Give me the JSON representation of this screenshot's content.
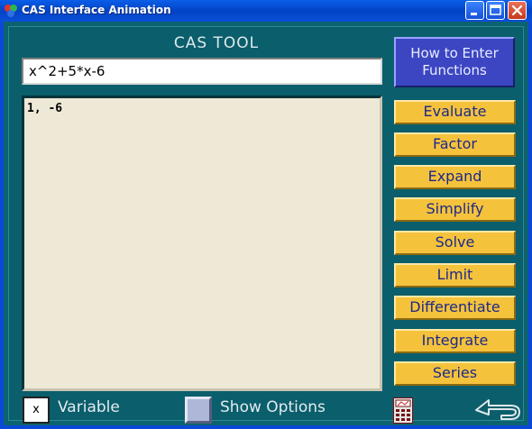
{
  "window": {
    "title": "CAS Interface Animation",
    "icons": {
      "app": "app-logo-icon",
      "minimize": "minimize-icon",
      "maximize": "maximize-icon",
      "close": "close-icon"
    }
  },
  "tool": {
    "title": "CAS TOOL",
    "expression_input": {
      "value": "x^2+5*x-6"
    },
    "output_text": "1, -6",
    "help_button": {
      "line1": "How to Enter",
      "line2": "Functions"
    },
    "commands": [
      "Evaluate",
      "Factor",
      "Expand",
      "Simplify",
      "Solve",
      "Limit",
      "Differentiate",
      "Integrate",
      "Series"
    ],
    "variable": {
      "value": "x",
      "label": "Variable"
    },
    "options": {
      "label": "Show Options",
      "checked": false
    },
    "footer_icons": {
      "calculator": "calculator-icon",
      "back": "back-arrow-icon"
    }
  },
  "colors": {
    "background": "#0b5e6b",
    "title_bar": "#0a4fd8",
    "command_button": "#f5c23c",
    "command_text": "#1b2a8a",
    "help_button": "#3c46c2",
    "output_background": "#eee8d6"
  }
}
